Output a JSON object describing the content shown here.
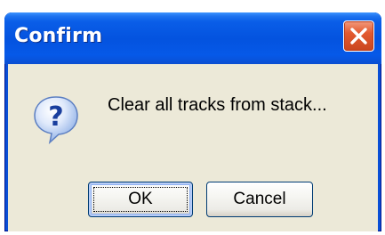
{
  "dialog": {
    "title": "Confirm",
    "message": "Clear all tracks from stack...",
    "icon": "question-icon",
    "close_icon": "close-icon",
    "buttons": {
      "ok_label": "OK",
      "cancel_label": "Cancel"
    },
    "colors": {
      "titlebar": "#0453df",
      "close_button": "#e3592f",
      "client_background": "#ece9d8",
      "button_border": "#003c74"
    }
  }
}
